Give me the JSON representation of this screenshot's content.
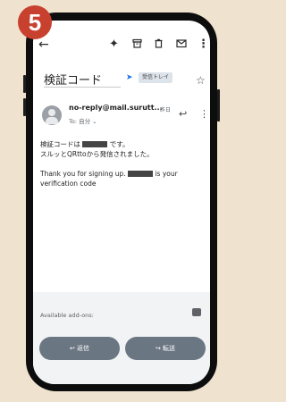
{
  "step_badge": "5",
  "toolbar": {
    "back_icon": "arrow-left-icon",
    "sparkle_icon": "sparkle-icon",
    "archive_icon": "archive-icon",
    "delete_icon": "trash-icon",
    "mark_unread_icon": "envelope-icon",
    "more_icon": "more-vert-icon"
  },
  "email": {
    "subject": "検証コード",
    "label": "受信トレイ",
    "sender": "no-reply@mail.surutt...",
    "time": "昨日",
    "to": "To: 自分 ⌄",
    "body_line1_pre": "検証コードは",
    "body_line1_post": "です。",
    "body_line2": "スルッとQRttoから発信されました。",
    "body_line3_pre": "Thank you for signing up.",
    "body_line3_post": "is your",
    "body_line4": "verification code"
  },
  "addons": {
    "label": "Available add-ons:"
  },
  "actions": {
    "reply": "返信",
    "forward": "転送"
  },
  "colors": {
    "badge": "#c8412f",
    "button": "#6b7683",
    "label_arrow": "#1a73e8"
  }
}
